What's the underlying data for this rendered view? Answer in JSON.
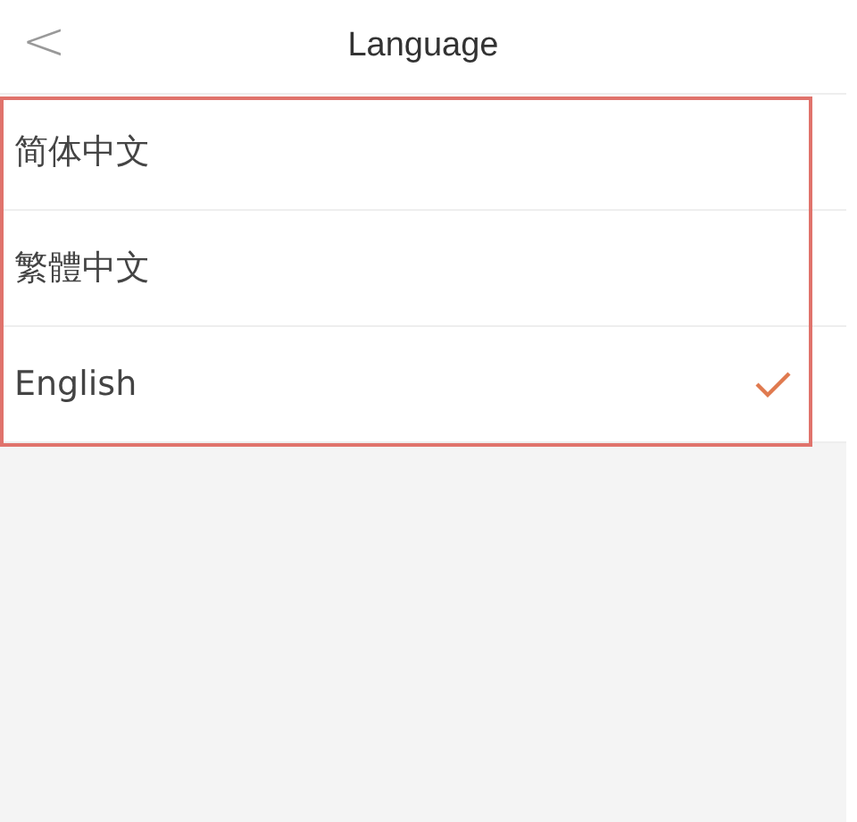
{
  "header": {
    "title": "Language",
    "back_icon": "<"
  },
  "languages": [
    {
      "label": "简体中文",
      "selected": false
    },
    {
      "label": "繁體中文",
      "selected": false
    },
    {
      "label": "English",
      "selected": true
    }
  ],
  "highlight_frame": true
}
